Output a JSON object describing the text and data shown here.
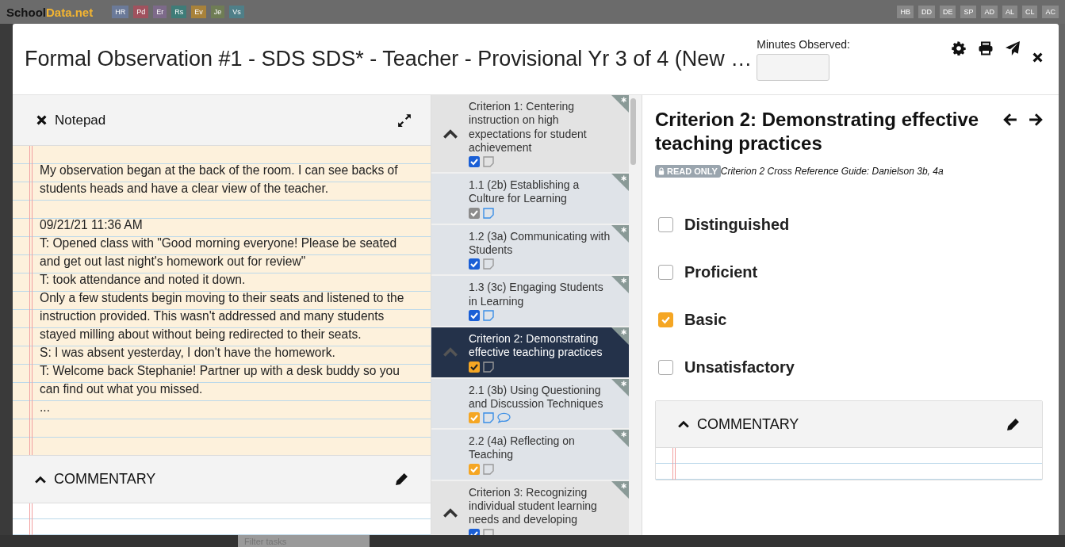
{
  "background": {
    "logo": {
      "first": "School",
      "second": "Data.net"
    },
    "left_tags": [
      {
        "label": "HR",
        "color": "#6b7a99"
      },
      {
        "label": "Pd",
        "color": "#a0525e"
      },
      {
        "label": "Er",
        "color": "#7d6a8a"
      },
      {
        "label": "Rs",
        "color": "#3f7c78"
      },
      {
        "label": "Ev",
        "color": "#a8823a"
      },
      {
        "label": "Je",
        "color": "#6f7d55"
      },
      {
        "label": "Vs",
        "color": "#4f7f88"
      }
    ],
    "right_tags": [
      {
        "label": "HB",
        "color": "#888888"
      },
      {
        "label": "DD",
        "color": "#888888"
      },
      {
        "label": "DE",
        "color": "#888888"
      },
      {
        "label": "SP",
        "color": "#888888"
      },
      {
        "label": "AD",
        "color": "#888888"
      },
      {
        "label": "AL",
        "color": "#888888"
      },
      {
        "label": "CL",
        "color": "#888888"
      },
      {
        "label": "AC",
        "color": "#888888"
      }
    ],
    "filter": {
      "placeholder": "Filter tasks"
    }
  },
  "modal": {
    "title": "Formal Observation #1 - SDS SDS* - Teacher - Provisional Yr 3 of 4 (New …",
    "minutes": {
      "label": "Minutes Observed:"
    }
  },
  "notepad": {
    "title": "Notepad",
    "paragraphs": [
      {
        "text": "My observation began at the back of the room. I can see backs of students heads and have a clear view of the teacher.",
        "spacer_after": true
      },
      {
        "text": "09/21/21 11:36 AM",
        "spacer_after": false
      },
      {
        "text": "T: Opened class with \"Good morning everyone! Please be seated and get out last night's homework out for review\"",
        "spacer_after": false
      },
      {
        "text": "T: took attendance and noted it down.",
        "spacer_after": false
      },
      {
        "text": "Only a few students begin moving to their seats and listened to the instruction provided. This wasn't addressed and many students stayed milling about without being redirected to their seats.",
        "spacer_after": false
      },
      {
        "text": "S: I was absent yesterday, I don't have the homework.",
        "spacer_after": false
      },
      {
        "text": "T: Welcome back Stephanie! Partner up with a desk buddy so you can find out what you missed.",
        "spacer_after": false
      },
      {
        "text": "...",
        "spacer_after": false
      }
    ],
    "commentary": {
      "title": "COMMENTARY",
      "expanded": true
    }
  },
  "criteria_list": [
    {
      "kind": "criterion",
      "title": "Criterion 1: Centering instruction on high expectations for student achievement",
      "selected": false,
      "color": "#1a5fd6",
      "has_note": false,
      "has_comment": false
    },
    {
      "kind": "component",
      "title": "1.1 (2b) Establishing a Culture for Learning",
      "selected": false,
      "color": "#8c8c8c",
      "has_note": true,
      "has_comment": false
    },
    {
      "kind": "component",
      "title": "1.2 (3a) Communicating with Students",
      "selected": false,
      "color": "#1a5fd6",
      "has_note": false,
      "has_comment": false
    },
    {
      "kind": "component",
      "title": "1.3 (3c) Engaging Students in Learning",
      "selected": false,
      "color": "#1a5fd6",
      "has_note": true,
      "has_comment": false
    },
    {
      "kind": "criterion",
      "title": "Criterion 2: Demonstrating effective teaching practices",
      "selected": true,
      "color": "#f5a623",
      "has_note": false,
      "has_comment": false
    },
    {
      "kind": "component",
      "title": "2.1 (3b) Using Questioning and Discussion Techniques",
      "selected": false,
      "color": "#f5a623",
      "has_note": true,
      "has_comment": true
    },
    {
      "kind": "component",
      "title": "2.2 (4a) Reflecting on Teaching",
      "selected": false,
      "color": "#f5a623",
      "has_note": false,
      "has_comment": false
    },
    {
      "kind": "criterion",
      "title": "Criterion 3: Recognizing individual student learning needs and developing",
      "selected": false,
      "color": "#1a5fd6",
      "has_note": false,
      "has_comment": false
    }
  ],
  "detail": {
    "title": "Criterion 2: Demonstrating effective teaching practices",
    "badge": "READ ONLY",
    "guide": "Criterion 2 Cross Reference Guide: Danielson 3b, 4a",
    "ratings": [
      {
        "label": "Distinguished",
        "checked": false
      },
      {
        "label": "Proficient",
        "checked": false
      },
      {
        "label": "Basic",
        "checked": true
      },
      {
        "label": "Unsatisfactory",
        "checked": false
      }
    ],
    "commentary": {
      "title": "COMMENTARY",
      "expanded": true
    }
  }
}
